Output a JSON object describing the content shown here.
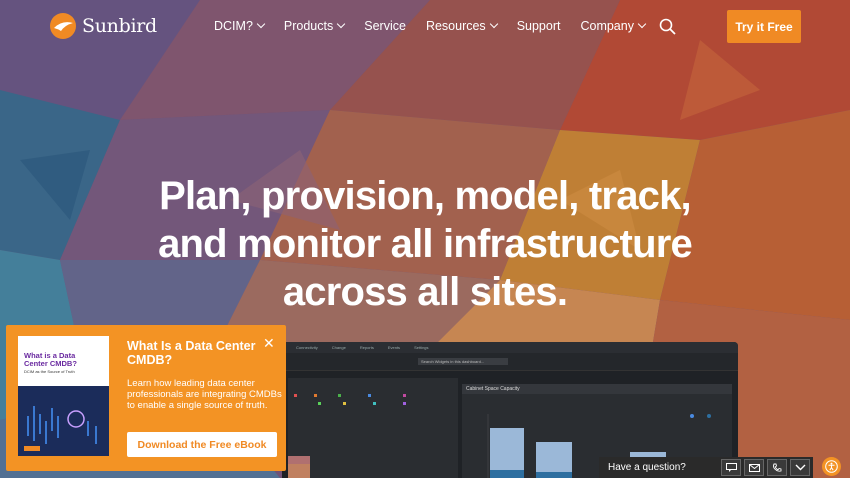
{
  "brand": {
    "name": "Sunbird",
    "accent": "#f08a24"
  },
  "nav": {
    "items": [
      {
        "label": "DCIM?",
        "dropdown": true
      },
      {
        "label": "Products",
        "dropdown": true
      },
      {
        "label": "Service",
        "dropdown": false
      },
      {
        "label": "Resources",
        "dropdown": true
      },
      {
        "label": "Support",
        "dropdown": false
      },
      {
        "label": "Company",
        "dropdown": true
      }
    ],
    "search_icon": "search-icon",
    "cta_label": "Try it Free"
  },
  "hero": {
    "line1": "Plan, provision, model, track,",
    "line2": "and monitor all infrastructure",
    "line3": "across all sites."
  },
  "dashboard": {
    "tabs": [
      "Connectivity",
      "Change",
      "Reports",
      "Events",
      "Settings"
    ],
    "search_placeholder": "Search Widgets in this dashboard...",
    "left_panel_title": "",
    "right_panel_title": "Cabinet Space Capacity"
  },
  "promo": {
    "book_title": "What is a Data Center CMDB?",
    "book_subtitle": "DCIM as the Source of Truth",
    "heading": "What Is a Data Center CMDB?",
    "body": "Learn how leading data center professionals are integrating CMDBs to enable a single source of truth.",
    "button_label": "Download the Free eBook",
    "close_icon": "close-icon"
  },
  "chat": {
    "label": "Have a question?"
  }
}
